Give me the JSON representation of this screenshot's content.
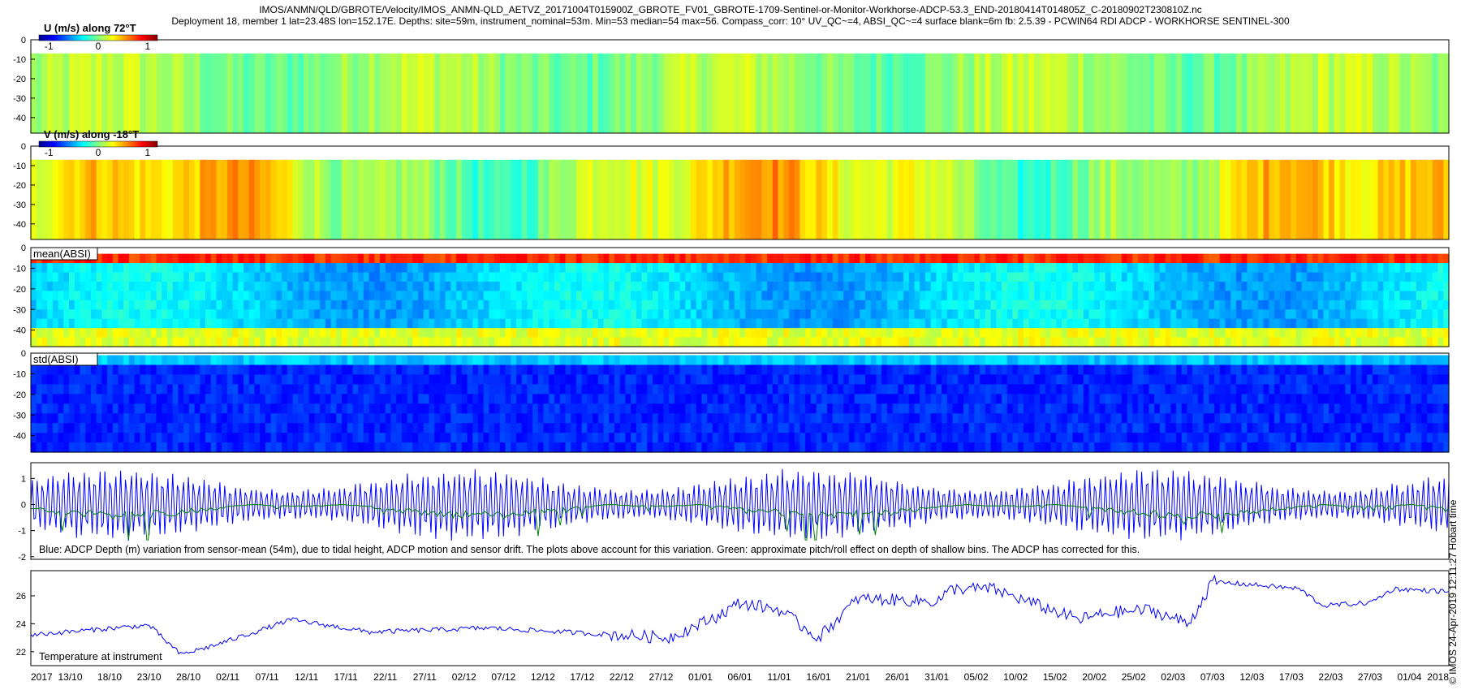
{
  "header": {
    "line1": "IMOS/ANMN/QLD/GBROTE/Velocity/IMOS_ANMN-QLD_AETVZ_20171004T015900Z_GBROTE_FV01_GBROTE-1709-Sentinel-or-Monitor-Workhorse-ADCP-53.3_END-20180414T014805Z_C-20180902T230810Z.nc",
    "line2": "Deployment 18, member 1 lat=23.48S lon=152.17E. Depths: site=59m, instrument_nominal=53m. Min=53 median=54 max=56. Compass_corr: 10° UV_QC~=4, ABSI_QC~=4 surface blank=6m fb: 2.5.39 - PCWIN64 RDI ADCP - WORKHORSE SENTINEL-300"
  },
  "side_label": "© IMOS 24-Apr-2019 12:11:27 Hobart time",
  "colors": {
    "depth_series": "#0000ff",
    "tilt_series": "#008000",
    "temperature_series": "#0000ff",
    "colormap": [
      "#00008f",
      "#0000ff",
      "#0080ff",
      "#00ffff",
      "#80ff80",
      "#ffff00",
      "#ff8000",
      "#ff0000",
      "#800000"
    ]
  },
  "time_axis": {
    "tick_labels": [
      "2017",
      "13/10",
      "18/10",
      "23/10",
      "28/10",
      "02/11",
      "07/11",
      "12/11",
      "17/11",
      "22/11",
      "27/11",
      "02/12",
      "07/12",
      "12/12",
      "17/12",
      "22/12",
      "27/12",
      "01/01",
      "06/01",
      "11/01",
      "16/01",
      "21/01",
      "26/01",
      "31/01",
      "05/02",
      "10/02",
      "15/02",
      "20/02",
      "25/02",
      "02/03",
      "07/03",
      "12/03",
      "17/03",
      "22/03",
      "27/03",
      "01/04",
      "2018"
    ],
    "tick_dates": [
      "2017-10-08",
      "2017-10-13",
      "2017-10-18",
      "2017-10-23",
      "2017-10-28",
      "2017-11-02",
      "2017-11-07",
      "2017-11-12",
      "2017-11-17",
      "2017-11-22",
      "2017-11-27",
      "2017-12-02",
      "2017-12-07",
      "2017-12-12",
      "2017-12-17",
      "2017-12-22",
      "2017-12-27",
      "2018-01-01",
      "2018-01-06",
      "2018-01-11",
      "2018-01-16",
      "2018-01-21",
      "2018-01-26",
      "2018-01-31",
      "2018-02-05",
      "2018-02-10",
      "2018-02-15",
      "2018-02-20",
      "2018-02-25",
      "2018-03-02",
      "2018-03-07",
      "2018-03-12",
      "2018-03-17",
      "2018-03-22",
      "2018-03-27",
      "2018-04-01",
      "2018-04-06"
    ],
    "start": "2017-10-08",
    "end": "2018-04-06"
  },
  "chart_data": [
    {
      "type": "heatmap",
      "title": "U (m/s) along 72°T",
      "colorbar": {
        "ticks": [
          "-1",
          "0",
          "1"
        ],
        "range": [
          -1.2,
          1.2
        ]
      },
      "y_ticks": [
        "0",
        "-10",
        "-20",
        "-30",
        "-40"
      ],
      "ylim": [
        -48,
        0
      ],
      "rows": [
        -7,
        -48
      ],
      "typical_range": [
        -0.3,
        0.3
      ]
    },
    {
      "type": "heatmap",
      "title": "V (m/s) along -18°T",
      "colorbar": {
        "ticks": [
          "-1",
          "0",
          "1"
        ],
        "range": [
          -1.2,
          1.2
        ]
      },
      "y_ticks": [
        "0",
        "-10",
        "-20",
        "-30",
        "-40"
      ],
      "ylim": [
        -48,
        0
      ],
      "rows": [
        -7,
        -48
      ],
      "typical_range": [
        -0.4,
        0.8
      ]
    },
    {
      "type": "heatmap",
      "title": "mean(ABSI)",
      "y_ticks": [
        "0",
        "-10",
        "-20",
        "-30",
        "-40"
      ],
      "ylim": [
        -48,
        0
      ],
      "rows": [
        -3,
        -48
      ]
    },
    {
      "type": "heatmap",
      "title": "std(ABSI)",
      "y_ticks": [
        "0",
        "-10",
        "-20",
        "-30",
        "-40"
      ],
      "ylim": [
        -48,
        0
      ],
      "rows": [
        -1,
        -48
      ]
    },
    {
      "type": "line",
      "annotation": "Blue: ADCP Depth (m) variation from sensor-mean (54m), due to tidal height, ADCP motion and sensor drift. The plots above account for this variation. Green: approximate pitch/roll effect on depth of shallow bins. The ADCP has corrected for this.",
      "y_ticks": [
        "1",
        "0",
        "-1",
        "-2"
      ],
      "ylim": [
        -2.1,
        1.6
      ],
      "series": [
        {
          "color": "blue",
          "amplitude_range": [
            0.7,
            1.4
          ],
          "mean": 0
        },
        {
          "color": "green",
          "range": [
            -2,
            0
          ]
        }
      ]
    },
    {
      "type": "line",
      "title": "Temperature at instrument",
      "y_ticks": [
        "26",
        "24",
        "22"
      ],
      "ylim": [
        21,
        27.8
      ],
      "series": [
        {
          "color": "blue",
          "x": [
            "2017-10-08",
            "2017-10-23",
            "2017-10-27",
            "2017-10-31",
            "2017-11-07",
            "2017-11-10",
            "2017-11-20",
            "2017-12-05",
            "2017-12-15",
            "2017-12-28",
            "2018-01-03",
            "2018-01-06",
            "2018-01-11",
            "2018-01-16",
            "2018-01-21",
            "2018-01-31",
            "2018-02-02",
            "2018-02-07",
            "2018-02-12",
            "2018-02-18",
            "2018-02-22",
            "2018-02-27",
            "2018-03-04",
            "2018-03-07",
            "2018-03-12",
            "2018-03-18",
            "2018-03-21",
            "2018-03-27",
            "2018-03-30",
            "2018-04-06"
          ],
          "y": [
            23.2,
            23.9,
            21.8,
            22.4,
            23.7,
            24.3,
            23.4,
            23.7,
            23.4,
            23.0,
            24.5,
            25.5,
            25.0,
            23.0,
            25.8,
            25.6,
            26.5,
            26.5,
            25.5,
            24.3,
            24.8,
            25.0,
            24.0,
            27.0,
            26.8,
            26.5,
            25.3,
            25.5,
            26.5,
            26.3
          ]
        }
      ]
    }
  ]
}
